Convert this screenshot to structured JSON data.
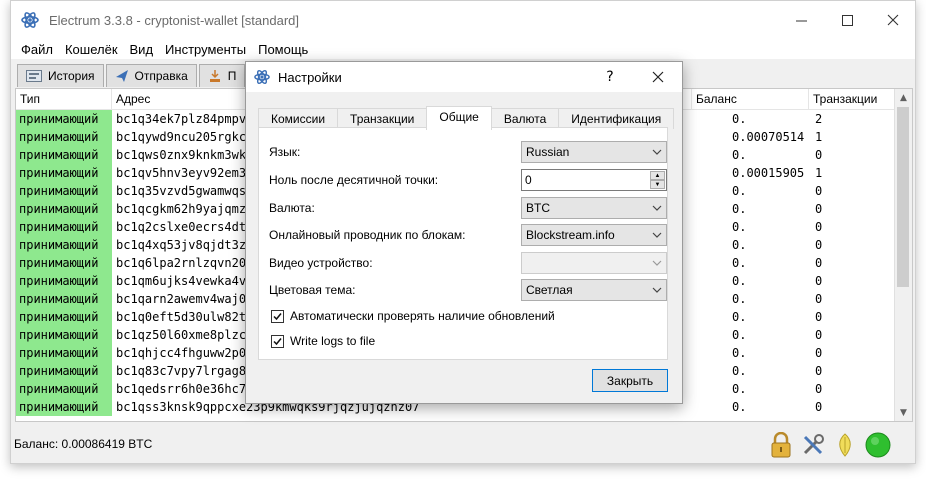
{
  "window": {
    "title": "Electrum 3.3.8  -  cryptonist-wallet  [standard]"
  },
  "menu": [
    "Файл",
    "Кошелёк",
    "Вид",
    "Инструменты",
    "Помощь"
  ],
  "main_tabs": [
    {
      "label": "История",
      "icon": "history-icon"
    },
    {
      "label": "Отправка",
      "icon": "send-icon"
    },
    {
      "label": "П",
      "icon": "receive-icon"
    }
  ],
  "table": {
    "headers": {
      "type": "Тип",
      "address": "Адрес",
      "balance": "Баланс",
      "tx": "Транзакции"
    },
    "rows": [
      {
        "type": "принимающий",
        "address": "bc1q34ek7plz84pmpv",
        "balance": "0.",
        "tx": "2"
      },
      {
        "type": "принимающий",
        "address": "bc1qywd9ncu205rgkc",
        "balance": "0.00070514",
        "tx": "1"
      },
      {
        "type": "принимающий",
        "address": "bc1qws0znx9knkm3wk",
        "balance": "0.",
        "tx": "0"
      },
      {
        "type": "принимающий",
        "address": "bc1qv5hnv3eyv92em3",
        "balance": "0.00015905",
        "tx": "1"
      },
      {
        "type": "принимающий",
        "address": "bc1q35vzvd5gwamwqs",
        "balance": "0.",
        "tx": "0"
      },
      {
        "type": "принимающий",
        "address": "bc1qcgkm62h9yajqmz",
        "balance": "0.",
        "tx": "0"
      },
      {
        "type": "принимающий",
        "address": "bc1q2cslxe0ecrs4dt",
        "balance": "0.",
        "tx": "0"
      },
      {
        "type": "принимающий",
        "address": "bc1q4xq53jv8qjdt3z",
        "balance": "0.",
        "tx": "0"
      },
      {
        "type": "принимающий",
        "address": "bc1q6lpa2rnlzqvn20",
        "balance": "0.",
        "tx": "0"
      },
      {
        "type": "принимающий",
        "address": "bc1qm6ujks4vewka4v",
        "balance": "0.",
        "tx": "0"
      },
      {
        "type": "принимающий",
        "address": "bc1qarn2awemv4waj0",
        "balance": "0.",
        "tx": "0"
      },
      {
        "type": "принимающий",
        "address": "bc1q0eft5d30ulw82t",
        "balance": "0.",
        "tx": "0"
      },
      {
        "type": "принимающий",
        "address": "bc1qz50l60xme8plzc",
        "balance": "0.",
        "tx": "0"
      },
      {
        "type": "принимающий",
        "address": "bc1qhjcc4fhguww2p0",
        "balance": "0.",
        "tx": "0"
      },
      {
        "type": "принимающий",
        "address": "bc1q83c7vpy7lrgag8",
        "balance": "0.",
        "tx": "0"
      },
      {
        "type": "принимающий",
        "address": "bc1qedsrr6h0e36hc7",
        "balance": "0.",
        "tx": "0"
      },
      {
        "type": "принимающий",
        "address": "bc1qss3knsk9qppcxe23p9kmwqks9rjqzjujqznz07",
        "balance": "0.",
        "tx": "0"
      }
    ]
  },
  "status": {
    "balance": "Баланс: 0.00086419 BTC"
  },
  "dialog": {
    "title": "Настройки",
    "help": "?",
    "tabs": [
      {
        "label": "Комиссии",
        "active": false
      },
      {
        "label": "Транзакции",
        "active": false
      },
      {
        "label": "Общие",
        "active": true
      },
      {
        "label": "Валюта",
        "active": false
      },
      {
        "label": "Идентификация",
        "active": false
      }
    ],
    "fields": {
      "language": {
        "label": "Язык:",
        "value": "Russian"
      },
      "decimal_zeros": {
        "label": "Ноль после десятичной точки:",
        "value": "0"
      },
      "currency": {
        "label": "Валюта:",
        "value": "BTC"
      },
      "explorer": {
        "label": "Онлайновый проводник по блокам:",
        "value": "Blockstream.info"
      },
      "video_device": {
        "label": "Видео устройство:",
        "value": ""
      },
      "theme": {
        "label": "Цветовая тема:",
        "value": "Светлая"
      }
    },
    "checkboxes": [
      {
        "label": "Автоматически проверять наличие обновлений",
        "checked": true
      },
      {
        "label": "Write logs to file",
        "checked": true
      }
    ],
    "close_button": "Закрыть"
  },
  "colors": {
    "receiving_row": "#8ee88e",
    "accent": "#0078d7",
    "status_green": "#2fbf2f"
  }
}
